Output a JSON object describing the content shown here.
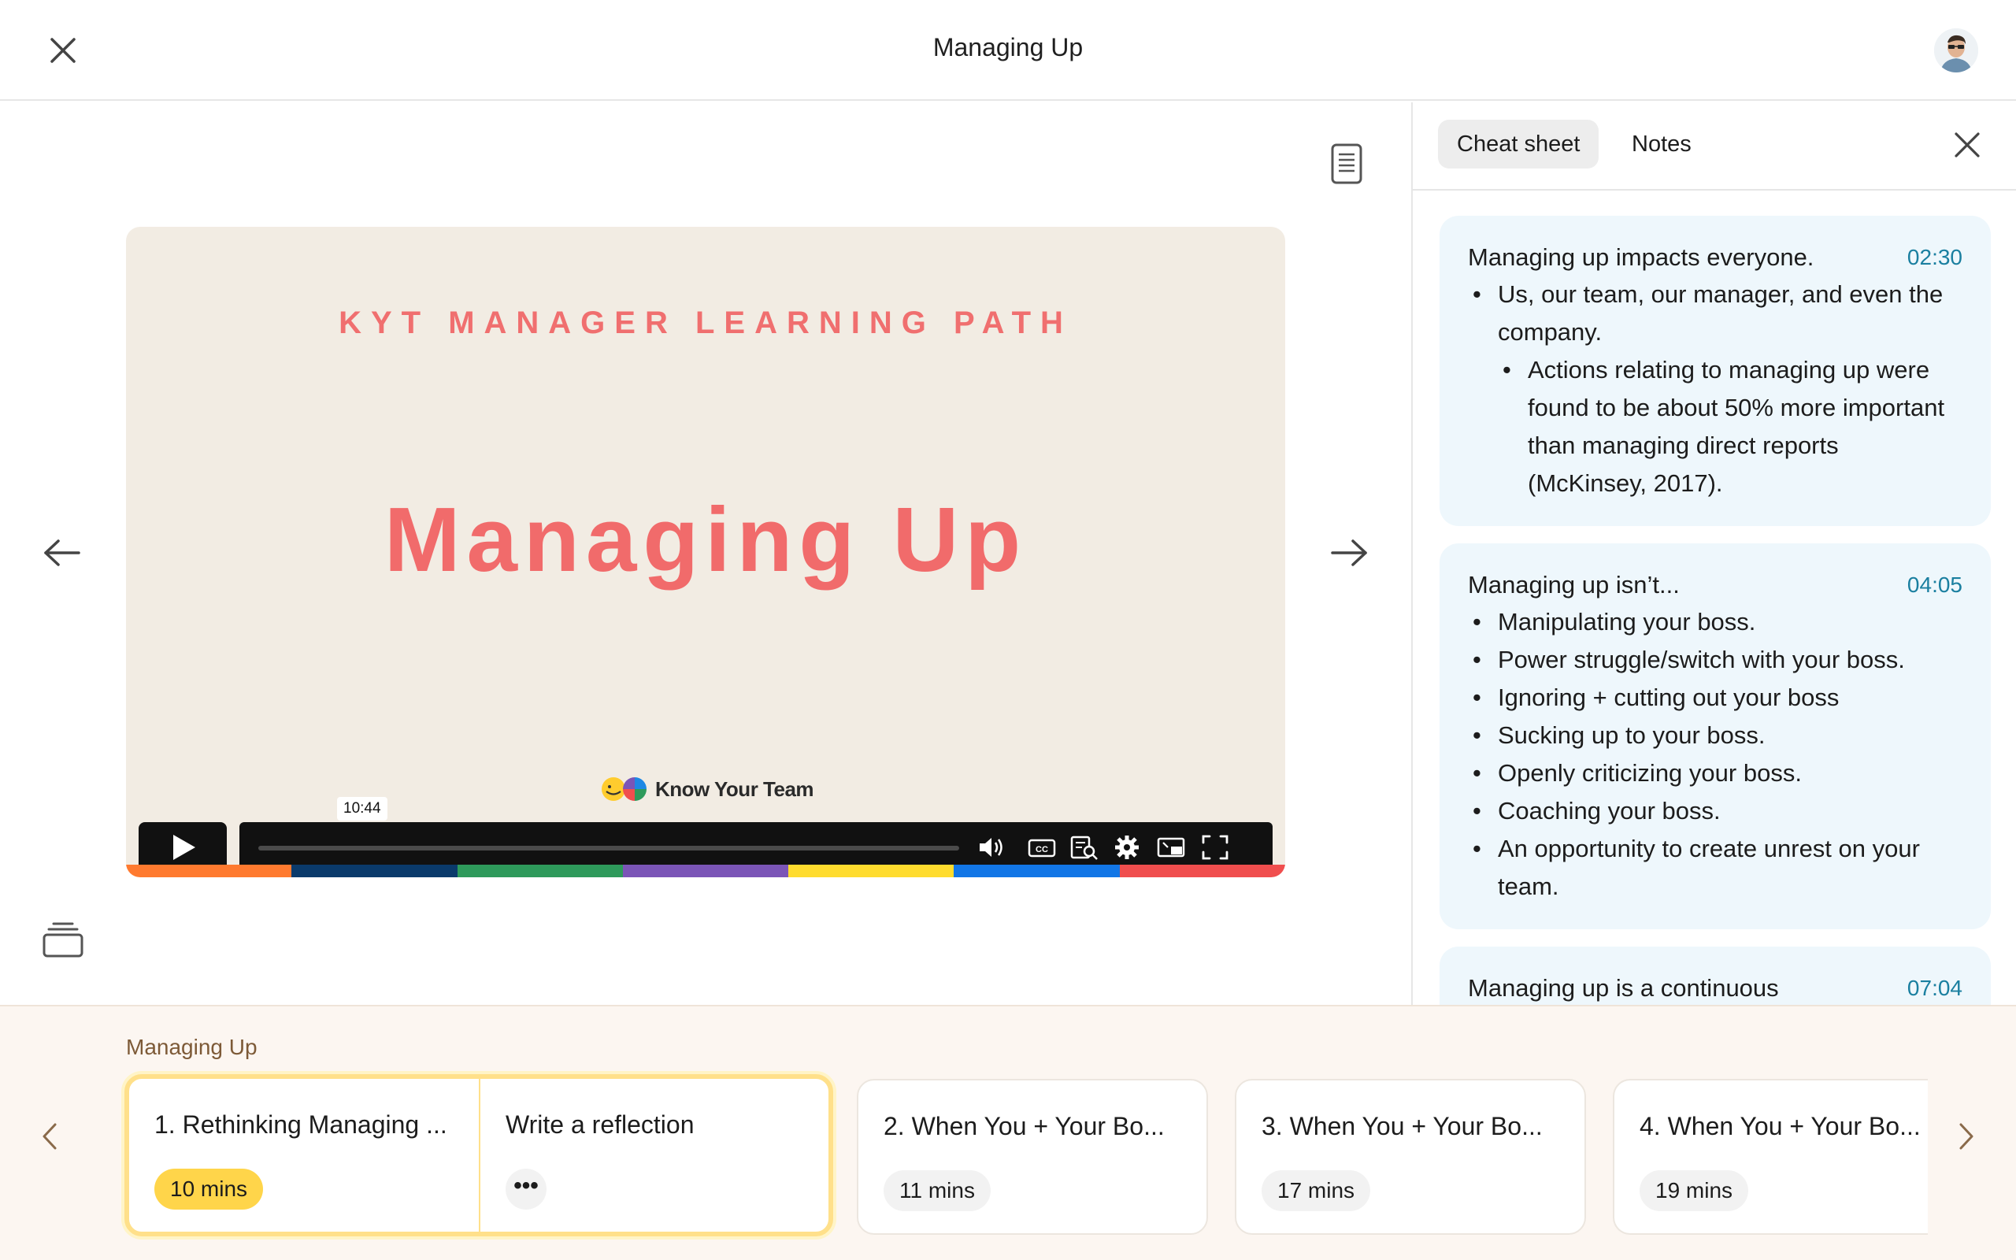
{
  "header": {
    "title": "Managing Up",
    "close_icon": "close-icon",
    "avatar_icon": "user-avatar"
  },
  "video": {
    "eyebrow": "KYT MANAGER LEARNING PATH",
    "title": "Managing Up",
    "brand": "Know Your Team",
    "time_tooltip": "10:44",
    "progress": 0.0,
    "rainbow_colors": [
      "#ff7a2f",
      "#0a3a6b",
      "#2e9a5b",
      "#7b55b7",
      "#ffdc2e",
      "#1276e6",
      "#f04e4e"
    ]
  },
  "panel": {
    "tabs": [
      {
        "label": "Cheat sheet",
        "active": true
      },
      {
        "label": "Notes",
        "active": false
      }
    ],
    "cards": [
      {
        "heading": "Managing up impacts everyone.",
        "time": "02:30",
        "bullets": [
          {
            "text": "Us, our team, our manager, and even the company.",
            "level": 1
          },
          {
            "text": "Actions relating to managing up were found to be about 50% more important than managing direct reports (McKinsey, 2017).",
            "level": 2
          }
        ]
      },
      {
        "heading": "Managing up isn’t...",
        "time": "04:05",
        "bullets": [
          {
            "text": "Manipulating your boss.",
            "level": 1
          },
          {
            "text": "Power struggle/switch with your boss.",
            "level": 1
          },
          {
            "text": "Ignoring + cutting out your boss",
            "level": 1
          },
          {
            "text": "Sucking up to your boss.",
            "level": 1
          },
          {
            "text": "Openly criticizing your boss.",
            "level": 1
          },
          {
            "text": "Coaching your boss.",
            "level": 1
          },
          {
            "text": "An opportunity to create unrest on your team.",
            "level": 1
          }
        ]
      },
      {
        "heading": "Managing up is a continuous",
        "time": "07:04",
        "bullets": []
      }
    ]
  },
  "strip": {
    "label": "Managing Up",
    "lessons": [
      {
        "title": "1. Rethinking Managing ...",
        "duration": "10 mins"
      },
      {
        "title": "Write a reflection",
        "duration": "•••"
      },
      {
        "title": "2. When You + Your Bo...",
        "duration": "11 mins"
      },
      {
        "title": "3. When You + Your Bo...",
        "duration": "17 mins"
      },
      {
        "title": "4. When You + Your Bo...",
        "duration": "19 mins"
      }
    ]
  },
  "colors": {
    "accent_coral": "#f16b6b",
    "timestamp": "#1a7fa0",
    "card_bg": "#eef7fc",
    "active_border": "#ffe08a",
    "pill_yellow": "#ffd54a"
  }
}
